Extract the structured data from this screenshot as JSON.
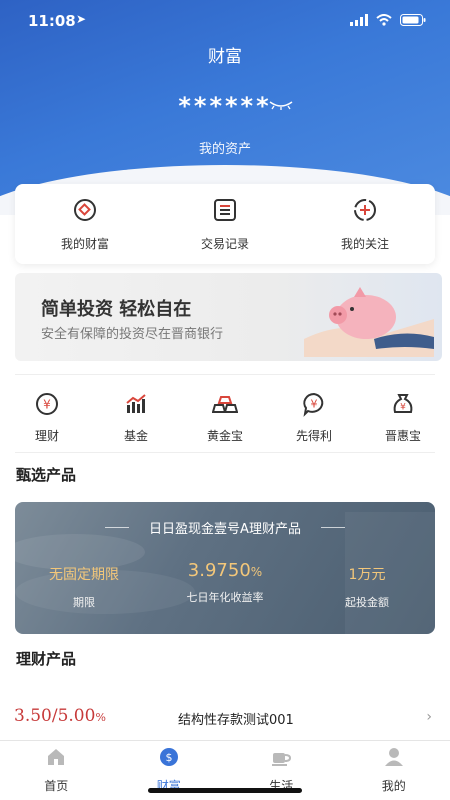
{
  "status": {
    "time": "11:08"
  },
  "header": {
    "title": "财富",
    "masked_assets": "******",
    "asset_label": "我的资产"
  },
  "quick": [
    {
      "label": "我的财富",
      "icon": "wealth-icon"
    },
    {
      "label": "交易记录",
      "icon": "records-icon"
    },
    {
      "label": "我的关注",
      "icon": "follow-icon"
    }
  ],
  "banner": {
    "headline": "简单投资  轻松自在",
    "subline": "安全有保障的投资尽在晋商银行"
  },
  "categories": [
    {
      "label": "理财",
      "icon": "yuan-circle-icon"
    },
    {
      "label": "基金",
      "icon": "bar-chart-icon"
    },
    {
      "label": "黄金宝",
      "icon": "gold-bars-icon"
    },
    {
      "label": "先得利",
      "icon": "yuan-bubble-icon"
    },
    {
      "label": "晋惠宝",
      "icon": "money-bag-icon"
    }
  ],
  "featured": {
    "section_title": "甄选产品",
    "name": "日日盈现金壹号A理财产品",
    "term_value": "无固定期限",
    "term_label": "期限",
    "yield_value": "3.9750",
    "yield_unit": "%",
    "yield_label": "七日年化收益率",
    "min_value": "1万元",
    "min_label": "起投金额"
  },
  "products": {
    "section_title": "理财产品",
    "items": [
      {
        "rate": "3.50/5.00",
        "rate_unit": "%",
        "name": "结构性存款测试001"
      }
    ]
  },
  "tabs": [
    {
      "label": "首页",
      "icon": "home-icon"
    },
    {
      "label": "财富",
      "icon": "wealth-coin-icon",
      "active": true
    },
    {
      "label": "生活",
      "icon": "cup-icon"
    },
    {
      "label": "我的",
      "icon": "user-icon"
    }
  ],
  "colors": {
    "accent": "#3a74d8",
    "hero": "#3a79d8",
    "gold_text": "#f3c77a",
    "rate_red": "#c73a3a"
  }
}
